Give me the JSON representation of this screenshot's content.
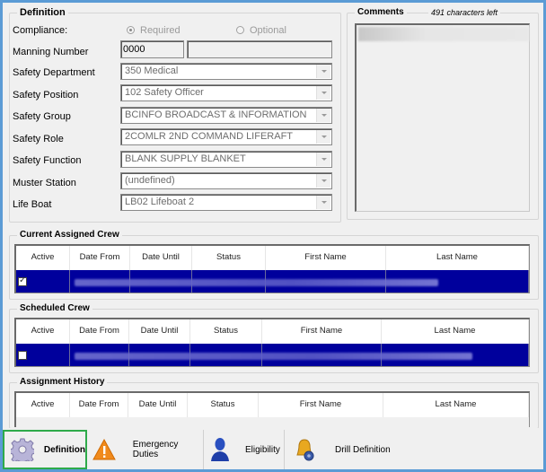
{
  "definition": {
    "legend": "Definition",
    "compliance": {
      "label": "Compliance:",
      "options": [
        {
          "label": "Required",
          "selected": true
        },
        {
          "label": "Optional",
          "selected": false
        }
      ]
    },
    "manning_number": {
      "label": "Manning Number",
      "value": "0000",
      "value2": ""
    },
    "fields": [
      {
        "label": "Safety Department",
        "value": "350 Medical"
      },
      {
        "label": "Safety Position",
        "value": "102 Safety Officer"
      },
      {
        "label": "Safety Group",
        "value": "BCINFO BROADCAST & INFORMATION"
      },
      {
        "label": "Safety Role",
        "value": "2COMLR 2ND COMMAND LIFERAFT"
      },
      {
        "label": "Safety Function",
        "value": "BLANK SUPPLY BLANKET"
      },
      {
        "label": "Muster Station",
        "value": "(undefined)"
      },
      {
        "label": "Life Boat",
        "value": "LB02 Lifeboat 2"
      }
    ]
  },
  "comments": {
    "legend": "Comments",
    "chars_left": "491 characters left",
    "value": ""
  },
  "columns": [
    "Active",
    "Date From",
    "Date Until",
    "Status",
    "First Name",
    "Last Name"
  ],
  "current_crew": {
    "legend": "Current Assigned Crew",
    "rows": [
      {
        "active": true
      }
    ]
  },
  "scheduled_crew": {
    "legend": "Scheduled Crew",
    "rows": [
      {
        "active": false
      }
    ]
  },
  "history": {
    "legend": "Assignment History",
    "rows": []
  },
  "tabs": [
    {
      "label": "Definition",
      "icon": "gear-icon",
      "active": true
    },
    {
      "label": "Emergency Duties",
      "icon": "warning-icon",
      "active": false
    },
    {
      "label": "Eligibility",
      "icon": "person-icon",
      "active": false
    },
    {
      "label": "Drill Definition",
      "icon": "bell-icon",
      "active": false
    }
  ],
  "colors": {
    "selection": "#00009c",
    "active_tab_border": "#2eaa4a",
    "window_frame": "#5b9bd5"
  }
}
